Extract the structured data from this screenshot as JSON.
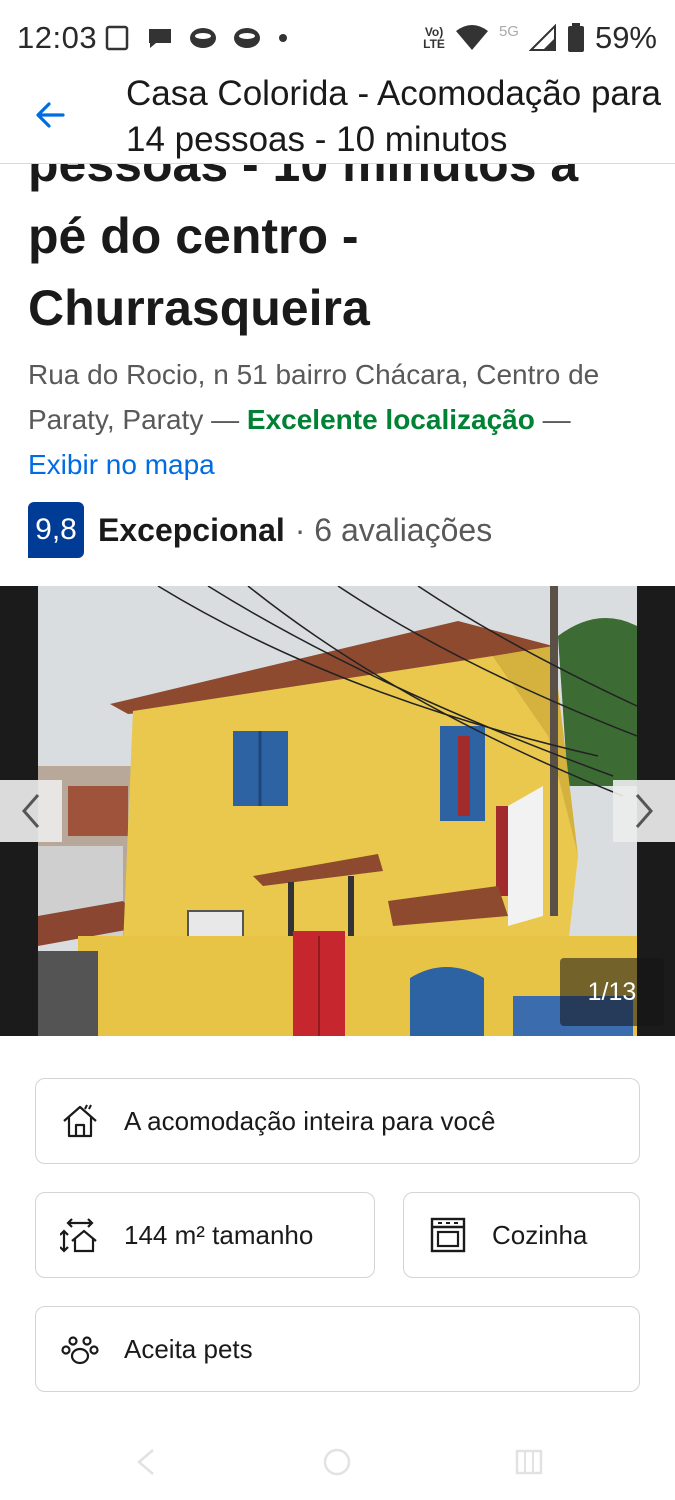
{
  "status_bar": {
    "time": "12:03",
    "network_label": "Vo) LTE",
    "network_label_top": "Vo)",
    "network_label_bottom": "LTE",
    "signal_type": "5G",
    "battery": "59%"
  },
  "app_bar": {
    "title": "Casa Colorida - Acomodação para 14 pessoas - 10 minutos"
  },
  "property": {
    "title_line1": "pessoas - 10 minutos a",
    "title_line2": "pé do centro -",
    "title_line3": "Churrasqueira",
    "address": "Rua do Rocio, n 51 bairro Chácara, Centro de Paraty, Paraty",
    "dash1": " — ",
    "location_highlight": "Excelente localização",
    "dash2": " —",
    "map_link": "Exibir no mapa",
    "score": "9,8",
    "score_word": "Excepcional",
    "reviews": "· 6 avaliações"
  },
  "gallery": {
    "counter": "1/13"
  },
  "facilities": {
    "entire_place": "A acomodação inteira para você",
    "size": "144 m² tamanho",
    "kitchen": "Cozinha",
    "pets": "Aceita pets"
  },
  "colors": {
    "accent_blue": "#006ce4",
    "score_bg": "#003b95",
    "good_green": "#008234"
  },
  "icons": [
    "back-arrow-icon",
    "house-icon",
    "size-icon",
    "kitchen-icon",
    "paw-icon",
    "chevron-left-icon",
    "chevron-right-icon"
  ]
}
